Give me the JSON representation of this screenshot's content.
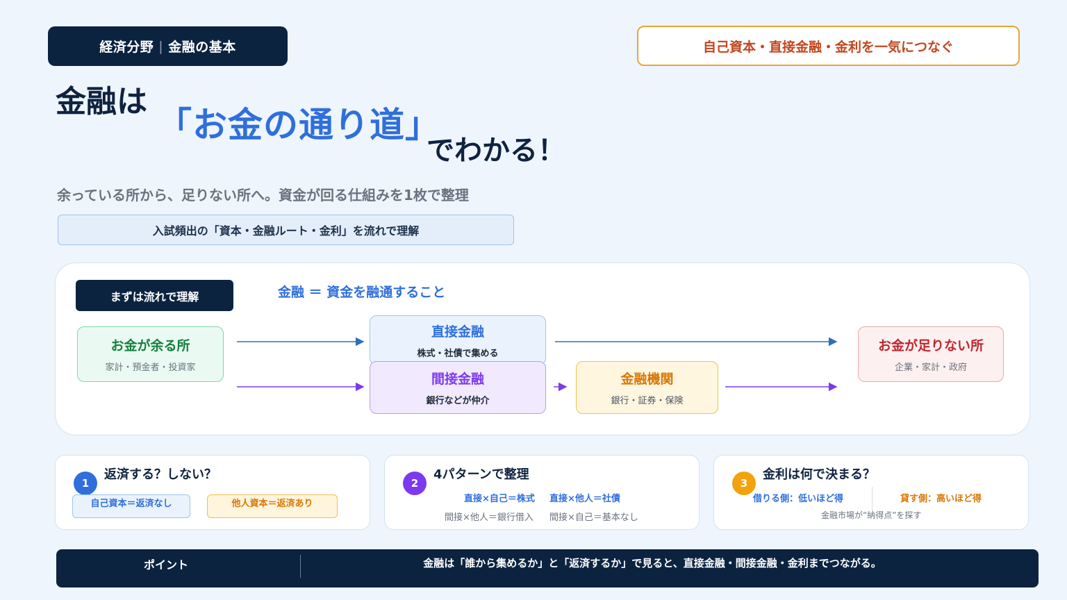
{
  "header": {
    "tag_left": "経済分野",
    "tag_right": "金融の基本",
    "tag_outline": "自己資本・直接金融・金利を一気につなぐ"
  },
  "title": {
    "part1": "金融は",
    "part2": "「お金の通り道」",
    "part3": "でわかる！"
  },
  "subtitle": "余っている所から、足りない所へ。資金が回る仕組みを1枚で整理",
  "note": "入試頻出の「資本・金融ルート・金利」を流れで理解",
  "flow": {
    "tag": "まずは流れで理解",
    "definition": "金融 ＝ 資金を融通すること",
    "source": {
      "title": "お金が余る所",
      "sub": "家計・預金者・投資家"
    },
    "direct": {
      "title": "直接金融",
      "sub": "株式・社債で集める"
    },
    "indirect": {
      "title": "間接金融",
      "sub": "銀行などが仲介"
    },
    "institution": {
      "title": "金融機関",
      "sub": "銀行・証券・保険"
    },
    "destination": {
      "title": "お金が足りない所",
      "sub": "企業・家計・政府"
    },
    "colors": {
      "direct_arrow": "#2f6fb8",
      "indirect_arrow": "#7c3aed"
    }
  },
  "cards": {
    "c1": {
      "num": "1",
      "title": "返済する？しない？",
      "chip_left": "自己資本＝返済なし",
      "chip_right": "他人資本＝返済あり"
    },
    "c2": {
      "num": "2",
      "title": "4パターンで整理",
      "p1": "直接×自己＝株式",
      "p2": "直接×他人＝社債",
      "p3": "間接×他人＝銀行借入",
      "p4": "間接×自己＝基本なし"
    },
    "c3": {
      "num": "3",
      "title": "金利は何で決まる？",
      "left": "借りる側：低いほど得",
      "right": "貸す側：高いほど得",
      "note": "金融市場が“納得点”を探す"
    }
  },
  "footer": {
    "label": "ポイント",
    "text": "金融は「誰から集めるか」と「返済するか」で見ると、直接金融・間接金融・金利までつながる。"
  }
}
